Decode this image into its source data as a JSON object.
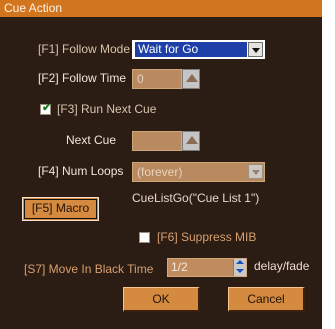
{
  "window": {
    "title": "Cue Action"
  },
  "follow": {
    "mode_label": "[F1] Follow Mode",
    "mode_value": "Wait for Go",
    "time_label": "[F2] Follow Time",
    "time_value": "0"
  },
  "run_next": {
    "label": "[F3] Run Next Cue",
    "checked": true,
    "next_cue_label": "Next Cue",
    "next_cue_value": ""
  },
  "loops": {
    "label": "[F4] Num Loops",
    "value": "(forever)"
  },
  "macro": {
    "button_label": "[F5] Macro",
    "text": "CueListGo(\"Cue List 1\")"
  },
  "suppress": {
    "label": "[F6] Suppress MIB",
    "checked": false
  },
  "move": {
    "label": "[S7] Move In Black Time",
    "value": "1/2",
    "unit": "delay/fade"
  },
  "actions": {
    "ok": "OK",
    "cancel": "Cancel"
  }
}
